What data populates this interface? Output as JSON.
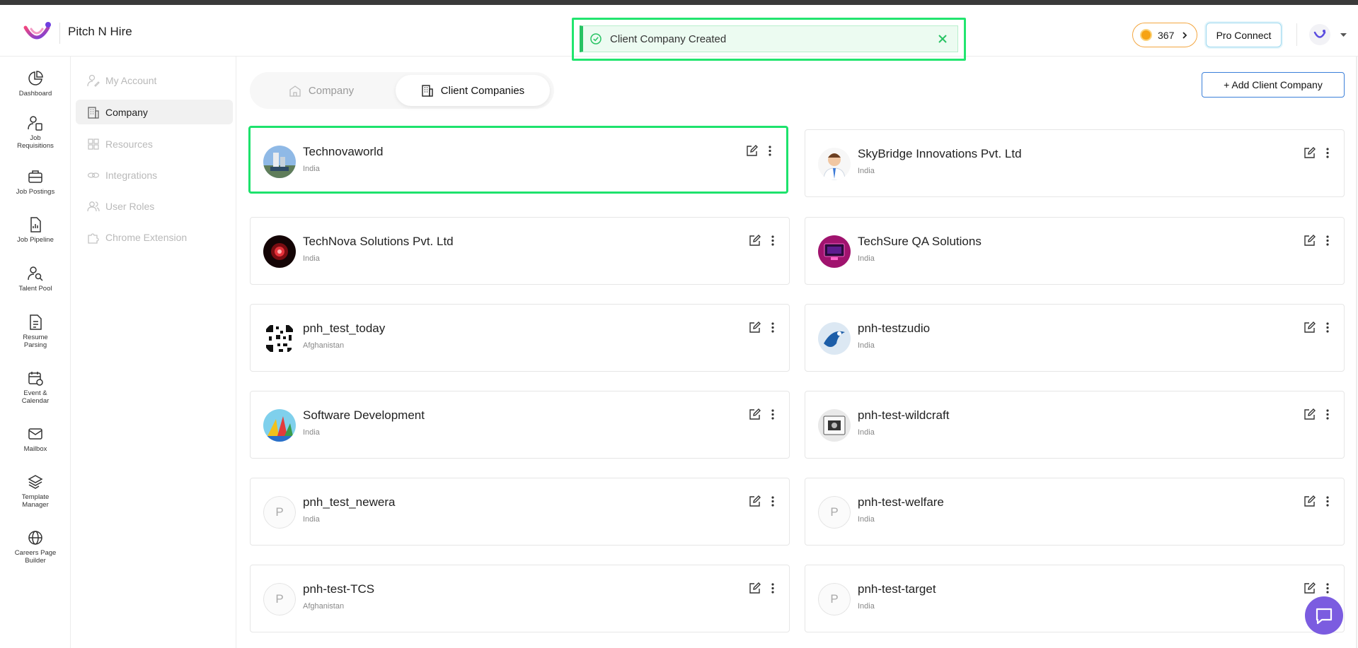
{
  "app": {
    "brand": "Pitch N Hire"
  },
  "toast": {
    "message": "Client Company Created"
  },
  "header": {
    "coins": "367",
    "pro_connect": "Pro Connect"
  },
  "colors": {
    "accent_green": "#22e56f",
    "accent_purple": "#7b5ce0",
    "coin": "#f6a313",
    "button_border": "#3b7fd9"
  },
  "leftnav": [
    {
      "id": "dashboard",
      "l1": "Dashboard",
      "l2": ""
    },
    {
      "id": "job-requisitions",
      "l1": "Job",
      "l2": "Requisitions"
    },
    {
      "id": "job-postings",
      "l1": "Job Postings",
      "l2": ""
    },
    {
      "id": "job-pipeline",
      "l1": "Job Pipeline",
      "l2": ""
    },
    {
      "id": "talent-pool",
      "l1": "Talent Pool",
      "l2": ""
    },
    {
      "id": "resume-parsing",
      "l1": "Resume",
      "l2": "Parsing"
    },
    {
      "id": "event-calendar",
      "l1": "Event &",
      "l2": "Calendar"
    },
    {
      "id": "mailbox",
      "l1": "Mailbox",
      "l2": ""
    },
    {
      "id": "template-manager",
      "l1": "Template",
      "l2": "Manager"
    },
    {
      "id": "careers-page-builder",
      "l1": "Careers Page",
      "l2": "Builder"
    }
  ],
  "subnav": [
    {
      "label": "My Account"
    },
    {
      "label": "Company"
    },
    {
      "label": "Resources"
    },
    {
      "label": "Integrations"
    },
    {
      "label": "User Roles"
    },
    {
      "label": "Chrome Extension"
    }
  ],
  "tabs": [
    {
      "label": "Company"
    },
    {
      "label": "Client Companies"
    }
  ],
  "actions": {
    "add_client_company": "+ Add Client Company"
  },
  "companies": [
    {
      "name": "Technovaworld",
      "country": "India",
      "logo": "building-photo"
    },
    {
      "name": "SkyBridge Innovations Pvt. Ltd",
      "country": "India",
      "logo": "person-avatar"
    },
    {
      "name": "TechNova Solutions Pvt. Ltd",
      "country": "India",
      "logo": "red-circle"
    },
    {
      "name": "TechSure QA Solutions",
      "country": "India",
      "logo": "pink-screen"
    },
    {
      "name": "pnh_test_today",
      "country": "Afghanistan",
      "logo": "qr-pattern"
    },
    {
      "name": "pnh-testzudio",
      "country": "India",
      "logo": "blue-bird"
    },
    {
      "name": "Software Development",
      "country": "India",
      "logo": "colorful-sail"
    },
    {
      "name": "pnh-test-wildcraft",
      "country": "India",
      "logo": "device-photo"
    },
    {
      "name": "pnh_test_newera",
      "country": "India",
      "logo": "placeholder",
      "initial": "P"
    },
    {
      "name": "pnh-test-welfare",
      "country": "India",
      "logo": "placeholder",
      "initial": "P"
    },
    {
      "name": "pnh-test-TCS",
      "country": "Afghanistan",
      "logo": "placeholder",
      "initial": "P"
    },
    {
      "name": "pnh-test-target",
      "country": "India",
      "logo": "placeholder",
      "initial": "P"
    }
  ]
}
